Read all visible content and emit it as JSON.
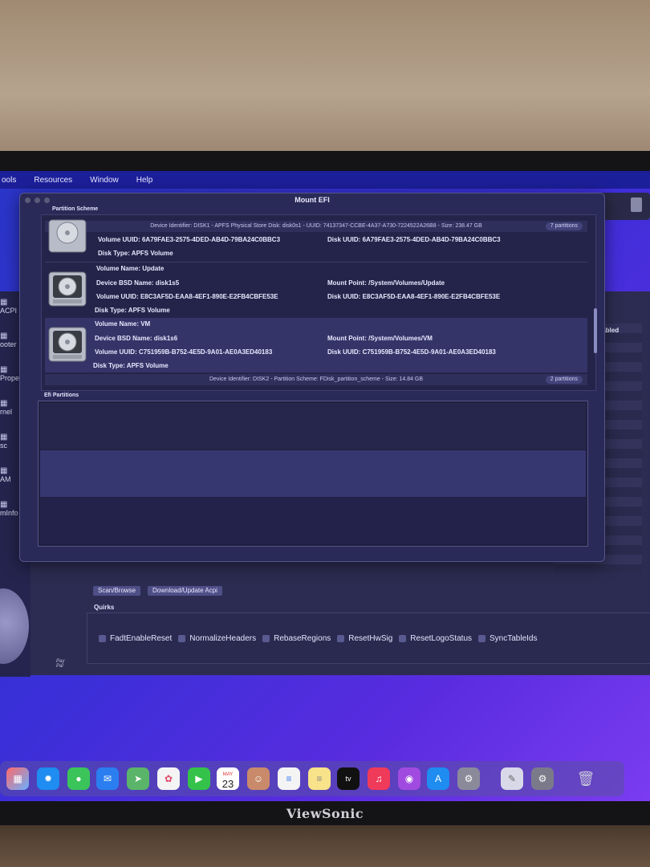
{
  "menubar": {
    "items": [
      "ools",
      "Resources",
      "Window",
      "Help"
    ]
  },
  "window": {
    "title": "Mount EFI"
  },
  "sections": {
    "partition_scheme": "Partition Scheme",
    "efi_partitions": "Efi Partitions"
  },
  "disk1": {
    "identifier": "Device Identifier: DISK1 - APFS Physical Store Disk: disk0s1 - UUID: 74137347-CCBE-4A37-A730-7224522A26B8 - Size: 238.47 GB",
    "badge": "7 partitions"
  },
  "volumes": [
    {
      "volume_uuid": "Volume UUID: 6A79FAE3-2575-4DED-AB4D-79BA24C0BBC3",
      "disk_uuid": "Disk UUID: 6A79FAE3-2575-4DED-AB4D-79BA24C0BBC3",
      "disk_type": "Disk Type: APFS Volume"
    },
    {
      "volume_name": "Volume Name: Update",
      "bsd_name": "Device BSD Name: disk1s5",
      "mount_point": "Mount Point: /System/Volumes/Update",
      "volume_uuid": "Volume UUID: E8C3AF5D-EAA8-4EF1-890E-E2FB4CBFE53E",
      "disk_uuid": "Disk UUID: E8C3AF5D-EAA8-4EF1-890E-E2FB4CBFE53E",
      "disk_type": "Disk Type: APFS Volume"
    },
    {
      "volume_name": "Volume Name: VM",
      "bsd_name": "Device BSD Name: disk1s6",
      "mount_point": "Mount Point: /System/Volumes/VM",
      "volume_uuid": "Volume UUID: C751959B-B752-4E5D-9A01-AE0A3ED40183",
      "disk_uuid": "Disk UUID: C751959B-B752-4E5D-9A01-AE0A3ED40183",
      "disk_type": "Disk Type: APFS Volume"
    }
  ],
  "disk2": {
    "identifier": "Device Identifier: DISK2 - Partition Scheme: FDisk_partition_scheme - Size: 14.84 GB",
    "badge": "2 partitions"
  },
  "sidebar": {
    "items": [
      "ACPI",
      "ooter",
      "Propertie",
      "rnel",
      "sc",
      "AM",
      "mInfo"
    ]
  },
  "back_table": {
    "header": "Enabled"
  },
  "buttons": {
    "scan": "Scan/Browse",
    "download": "Download/Update Acpi"
  },
  "pay_label": "Pay\nPal",
  "quirks": {
    "title": "Quirks",
    "items": [
      "FadtEnableReset",
      "NormalizeHeaders",
      "RebaseRegions",
      "ResetHwSig",
      "ResetLogoStatus",
      "SyncTableIds"
    ]
  },
  "dock": {
    "calendar_month": "MAY",
    "calendar_day": "23",
    "tv_label": "tv"
  },
  "monitor_brand": "ViewSonic",
  "colors": {
    "accent": "#3a2fd8",
    "window_bg": "#2a2a58",
    "menubar": "#1c1f9a"
  }
}
